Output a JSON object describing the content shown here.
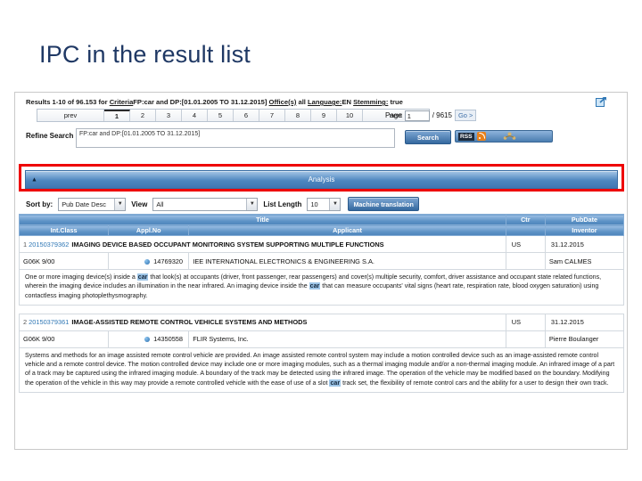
{
  "slide": {
    "title": "IPC in the result list"
  },
  "search": {
    "results_prefix": "Results 1-10 of 96.153 for ",
    "criteria_link": "Criteria",
    "criteria_value": "FP:car and DP:[01.01.2005 TO 31.12.2015] ",
    "office_link": "Office(s)",
    "office_value": " all ",
    "language_link": "Language:",
    "language_value": "EN ",
    "stemming_link": "Stemming:",
    "stemming_value": " true",
    "external_icon": "external-link-icon"
  },
  "pager": {
    "prev": "prev",
    "pages": [
      "1",
      "2",
      "3",
      "4",
      "5",
      "6",
      "7",
      "8",
      "9",
      "10"
    ],
    "selected": "1",
    "next": "next",
    "page_label": "Page",
    "page_value": "1",
    "page_total": "/ 9615",
    "go_label": "Go >"
  },
  "refine": {
    "label": "Refine Search",
    "value": "FP:car and DP:[01.01.2005 TO 31.12.2015]",
    "placeholder": "",
    "search_button": "Search",
    "rss_label": "RSS",
    "rss_icon": "rss-icon",
    "share_icon": "people-share-icon"
  },
  "analysis": {
    "label": "Analysis",
    "collapse_icon": "caret-up-icon",
    "highlight_color": "#ee0000"
  },
  "toolbar": {
    "sort_label": "Sort by:",
    "sort_value": "Pub Date Desc",
    "view_label": "View",
    "view_value": "All",
    "length_label": "List Length",
    "length_value": "10",
    "machine_translation": "Machine translation"
  },
  "table": {
    "headers_top": [
      "Title",
      "Ctr",
      "PubDate"
    ],
    "headers_sub": [
      "Int.Class",
      "Appl.No",
      "Applicant",
      "Inventor"
    ],
    "rows": [
      {
        "rank": "1",
        "number": "20150379362",
        "title": "IMAGING DEVICE BASED OCCUPANT MONITORING SYSTEM SUPPORTING MULTIPLE FUNCTIONS",
        "ctr": "US",
        "pubdate": "31.12.2015",
        "int_class": "G06K 9/00",
        "appl_no": "14769320",
        "applicant": "IEE INTERNATIONAL ELECTRONICS & ENGINEERING S.A.",
        "inventor": "Sam CALMES",
        "abstract_1": "One or more imaging device(s) inside a ",
        "abstract_hl1": "car",
        "abstract_2": " that look(s) at occupants (driver, front passenger, rear passengers) and cover(s) multiple security, comfort, driver assistance and occupant state related functions, wherein the imaging device includes an illumination in the near infrared. An imaging device inside the ",
        "abstract_hl2": "car",
        "abstract_3": " that can measure occupants' vital signs (heart rate, respiration rate, blood oxygen saturation) using contactless imaging photoplethysmography."
      },
      {
        "rank": "2",
        "number": "20150379361",
        "title": "IMAGE-ASSISTED REMOTE CONTROL VEHICLE SYSTEMS AND METHODS",
        "ctr": "US",
        "pubdate": "31.12.2015",
        "int_class": "G06K 9/00",
        "appl_no": "14350558",
        "applicant": "FLIR Systems, Inc.",
        "inventor": "Pierre Boulanger",
        "abstract_1": "Systems and methods for an image assisted remote control vehicle are provided. An image assisted remote control system may include a motion controlled device such as an image-assisted remote control vehicle and a remote control device. The motion controlled device may include one or more imaging modules, such as a thermal imaging module and/or a non-thermal imaging module. An infrared image of a part of a track may be captured using the infrared imaging module. A boundary of the track may be detected using the infrared image. The operation of the vehicle may be modified based on the boundary. Modifying the operation of the vehicle in this way may provide a remote controlled vehicle with the ease of use of a slot ",
        "abstract_hl1": "car",
        "abstract_2": " track set, the flexibility of remote control cars and the ability for a user to design their own track.",
        "abstract_hl2": "",
        "abstract_3": ""
      }
    ]
  }
}
